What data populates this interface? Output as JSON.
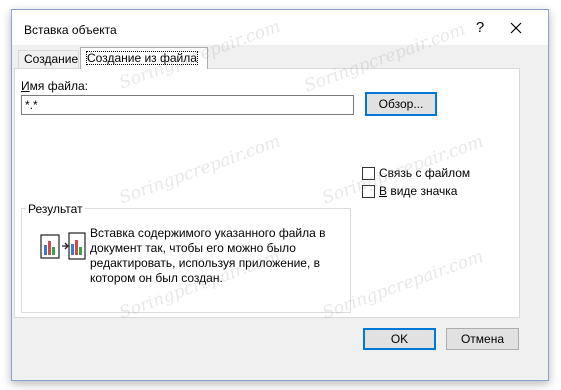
{
  "dialog": {
    "title": "Вставка объекта",
    "help_label": "?"
  },
  "tabs": [
    {
      "label": "Создание",
      "active": false
    },
    {
      "label": "Создание из файла",
      "active": true
    }
  ],
  "file": {
    "label_accel": "И",
    "label_rest": "мя файла:",
    "value": "*.*",
    "browse_label": "Обзор..."
  },
  "options": {
    "link_accel": "",
    "link_label": "Связь с файлом",
    "icon_accel": "В",
    "icon_label": " виде значка",
    "link_checked": false,
    "icon_checked": false
  },
  "result": {
    "title": "Результат",
    "text": "Вставка содержимого указанного файла в документ так, чтобы его можно было редактировать, используя приложение, в котором он был создан."
  },
  "buttons": {
    "ok": "OK",
    "cancel": "Отмена"
  },
  "watermark": "Soringpcrepair.com",
  "colors": {
    "accent": "#0078d7",
    "dialog_bg": "#f0f0f0",
    "panel_bg": "#ffffff"
  }
}
